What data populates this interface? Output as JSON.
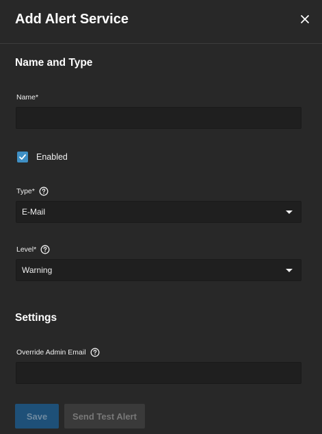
{
  "dialog": {
    "title": "Add Alert Service",
    "close_icon": "close-icon"
  },
  "sections": {
    "name_and_type": "Name and Type",
    "settings": "Settings"
  },
  "fields": {
    "name": {
      "label": "Name",
      "required_mark": "*",
      "value": ""
    },
    "enabled": {
      "label": "Enabled",
      "checked": true
    },
    "type": {
      "label": "Type",
      "required_mark": "*",
      "value": "E-Mail"
    },
    "level": {
      "label": "Level",
      "required_mark": "*",
      "value": "Warning"
    },
    "override_admin_email": {
      "label": "Override Admin Email",
      "value": ""
    }
  },
  "buttons": {
    "save": "Save",
    "send_test_alert": "Send Test Alert"
  },
  "colors": {
    "accent": "#3f8fc4",
    "background": "#282828",
    "input_background": "#1f1f1f"
  }
}
